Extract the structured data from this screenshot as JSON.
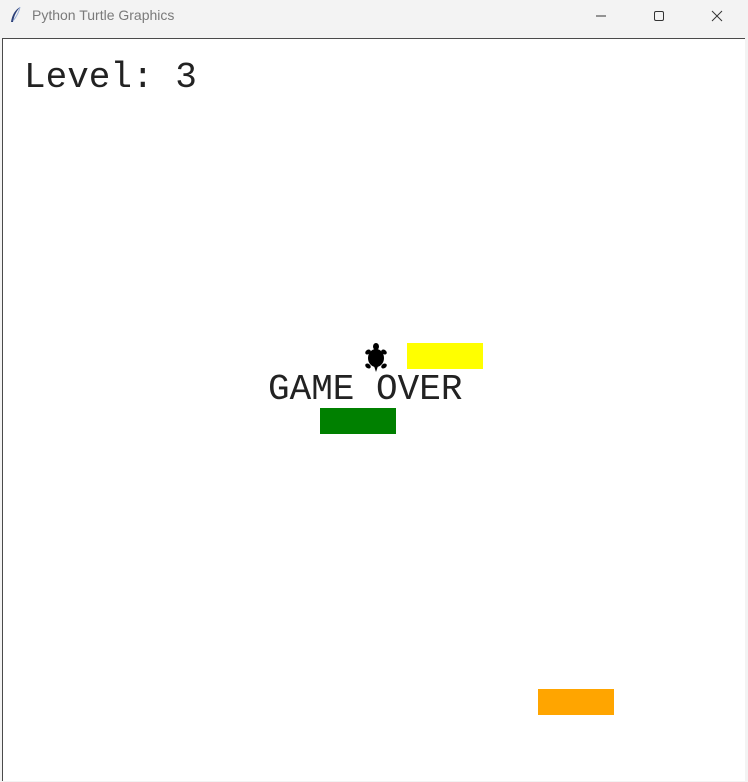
{
  "window": {
    "title": "Python Turtle Graphics",
    "icon": "tk-feather-icon",
    "controls": [
      "minimize-icon",
      "maximize-icon",
      "close-icon"
    ]
  },
  "game": {
    "level_text": "Level: 3",
    "status_text": "GAME OVER",
    "player": {
      "icon": "turtle-icon",
      "color": "#000000"
    },
    "cars": [
      {
        "name": "car-yellow",
        "color": "#ffff00"
      },
      {
        "name": "car-green",
        "color": "#008000"
      },
      {
        "name": "car-orange",
        "color": "#ffa500"
      }
    ]
  }
}
